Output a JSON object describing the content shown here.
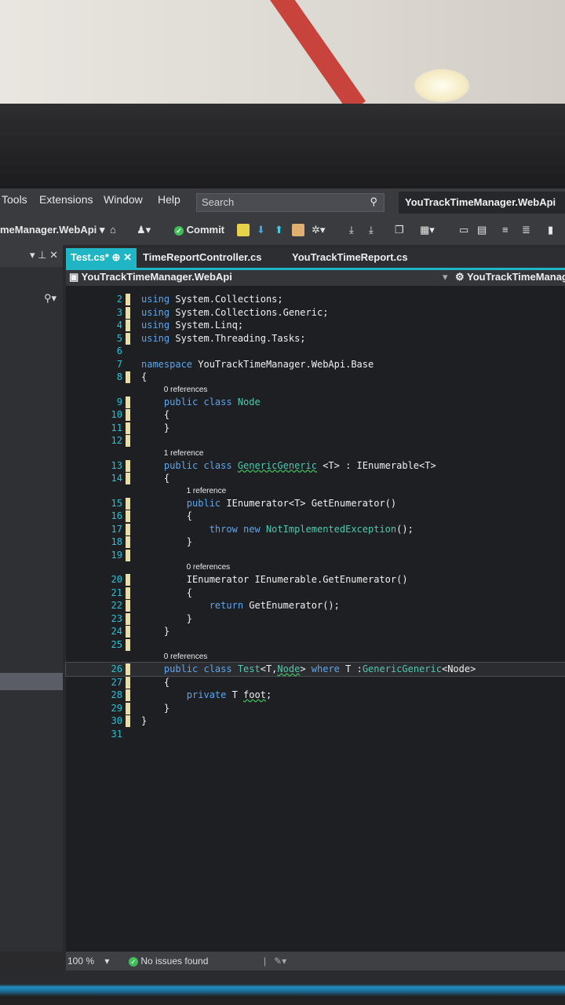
{
  "menu": {
    "items": [
      "Tools",
      "Extensions",
      "Window",
      "Help"
    ],
    "search_placeholder": "Search",
    "search_icon": "search-icon",
    "solution_title": "YouTrackTimeManager.WebApi"
  },
  "toolbar": {
    "project": "meManager.WebApi",
    "commit_label": "Commit"
  },
  "left_panel": {
    "controls": "▾ ⊥ ✕",
    "search_icon": "⚲▾"
  },
  "tabs": [
    {
      "label": "Test.cs*",
      "active": true,
      "pin": "⊕",
      "close": "✕"
    },
    {
      "label": "TimeReportController.cs"
    },
    {
      "label": "YouTrackTimeReport.cs"
    }
  ],
  "navbar": {
    "project": "YouTrackTimeManager.WebApi",
    "type": "YouTrackTimeManag"
  },
  "code": [
    {
      "n": "2",
      "chg": true,
      "t": [
        [
          "kw",
          "using "
        ],
        [
          "pl",
          "System.Collections;"
        ]
      ]
    },
    {
      "n": "3",
      "chg": true,
      "t": [
        [
          "kw",
          "using "
        ],
        [
          "pl",
          "System.Collections.Generic;"
        ]
      ]
    },
    {
      "n": "4",
      "chg": true,
      "t": [
        [
          "kw",
          "using "
        ],
        [
          "pl",
          "System.Linq;"
        ]
      ]
    },
    {
      "n": "5",
      "chg": true,
      "t": [
        [
          "kw",
          "using "
        ],
        [
          "pl",
          "System.Threading.Tasks;"
        ]
      ]
    },
    {
      "n": "6",
      "t": []
    },
    {
      "n": "7",
      "t": [
        [
          "kw",
          "namespace "
        ],
        [
          "pl",
          "YouTrackTimeManager.WebApi.Base"
        ]
      ]
    },
    {
      "n": "8",
      "chg": true,
      "t": [
        [
          "pl",
          "{"
        ]
      ]
    },
    {
      "lens": "0 references",
      "indent": "    "
    },
    {
      "n": "9",
      "chg": true,
      "t": [
        [
          "pl",
          "    "
        ],
        [
          "kw",
          "public class "
        ],
        [
          "ty",
          "Node"
        ]
      ]
    },
    {
      "n": "10",
      "chg": true,
      "t": [
        [
          "pl",
          "    {"
        ]
      ]
    },
    {
      "n": "11",
      "chg": true,
      "t": [
        [
          "pl",
          "    }"
        ]
      ]
    },
    {
      "n": "12",
      "chg": true,
      "t": []
    },
    {
      "lens": "1 reference",
      "indent": "    "
    },
    {
      "n": "13",
      "chg": true,
      "t": [
        [
          "pl",
          "    "
        ],
        [
          "kw",
          "public class "
        ],
        [
          "ty sq",
          "GenericGeneric"
        ],
        [
          "pl",
          " <T> : IEnumerable<T>"
        ]
      ]
    },
    {
      "n": "14",
      "chg": true,
      "t": [
        [
          "pl",
          "    {"
        ]
      ]
    },
    {
      "lens": "1 reference",
      "indent": "        "
    },
    {
      "n": "15",
      "chg": true,
      "t": [
        [
          "pl",
          "        "
        ],
        [
          "kw",
          "public "
        ],
        [
          "pl",
          "IEnumerator<T> GetEnumerator()"
        ]
      ]
    },
    {
      "n": "16",
      "chg": true,
      "t": [
        [
          "pl",
          "        {"
        ]
      ]
    },
    {
      "n": "17",
      "chg": true,
      "t": [
        [
          "pl",
          "            "
        ],
        [
          "kw",
          "throw new "
        ],
        [
          "ty",
          "NotImplementedException"
        ],
        [
          "pl",
          "();"
        ]
      ]
    },
    {
      "n": "18",
      "chg": true,
      "t": [
        [
          "pl",
          "        }"
        ]
      ]
    },
    {
      "n": "19",
      "chg": true,
      "t": []
    },
    {
      "lens": "0 references",
      "indent": "        "
    },
    {
      "n": "20",
      "chg": true,
      "t": [
        [
          "pl",
          "        IEnumerator IEnumerable.GetEnumerator()"
        ]
      ]
    },
    {
      "n": "21",
      "chg": true,
      "t": [
        [
          "pl",
          "        {"
        ]
      ]
    },
    {
      "n": "22",
      "chg": true,
      "t": [
        [
          "pl",
          "            "
        ],
        [
          "kw",
          "return "
        ],
        [
          "pl",
          "GetEnumerator();"
        ]
      ]
    },
    {
      "n": "23",
      "chg": true,
      "t": [
        [
          "pl",
          "        }"
        ]
      ]
    },
    {
      "n": "24",
      "chg": true,
      "t": [
        [
          "pl",
          "    }"
        ]
      ]
    },
    {
      "n": "25",
      "chg": true,
      "t": []
    },
    {
      "lens": "0 references",
      "indent": "    "
    },
    {
      "n": "26",
      "chg": true,
      "cur": true,
      "t": [
        [
          "pl",
          "    "
        ],
        [
          "kw",
          "public class "
        ],
        [
          "ty",
          "Test"
        ],
        [
          "pl",
          "<T,"
        ],
        [
          "ty sq",
          "Node"
        ],
        [
          "pl",
          "> "
        ],
        [
          "kw",
          "where "
        ],
        [
          "pl",
          "T :"
        ],
        [
          "ty",
          "GenericGeneric"
        ],
        [
          "pl",
          "<Node>"
        ]
      ]
    },
    {
      "n": "27",
      "chg": true,
      "t": [
        [
          "pl",
          "    {"
        ]
      ]
    },
    {
      "n": "28",
      "chg": true,
      "t": [
        [
          "pl",
          "        "
        ],
        [
          "kw",
          "private "
        ],
        [
          "pl",
          "T "
        ],
        [
          "pl sq",
          "foot"
        ],
        [
          "pl",
          ";"
        ]
      ]
    },
    {
      "n": "29",
      "chg": true,
      "t": [
        [
          "pl",
          "    }"
        ]
      ]
    },
    {
      "n": "30",
      "chg": true,
      "t": [
        [
          "pl",
          "}"
        ]
      ]
    },
    {
      "n": "31",
      "t": []
    }
  ],
  "status": {
    "zoom": "100 %",
    "issues": "No issues found"
  }
}
